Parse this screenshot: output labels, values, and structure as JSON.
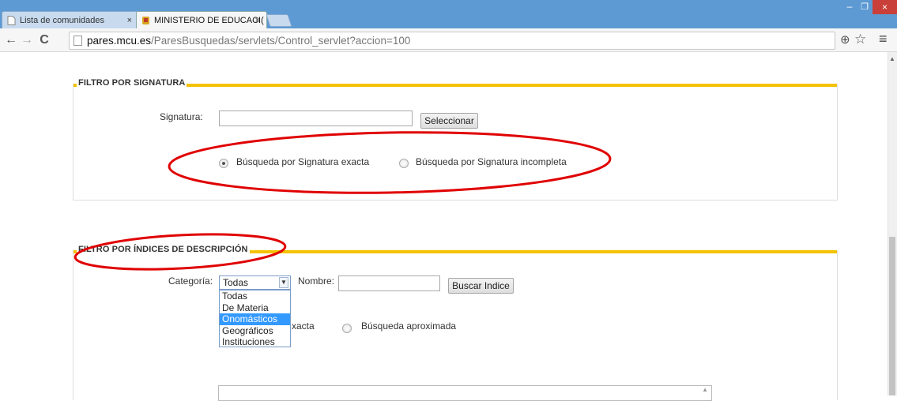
{
  "tabs": [
    {
      "label": "Lista de comunidades",
      "close": "×"
    },
    {
      "label": "MINISTERIO DE EDUCACI(",
      "close": "×"
    }
  ],
  "window": {
    "minimize": "–",
    "maximize": "❐",
    "close": "×"
  },
  "toolbar": {
    "url_host": "pares.mcu.es",
    "url_path": "/ParesBusquedas/servlets/Control_servlet?accion=100"
  },
  "signatura_filter": {
    "legend": "FILTRO POR SIGNATURA",
    "label": "Signatura:",
    "input_value": "",
    "button": "Seleccionar",
    "radio_exact": "Búsqueda por Signatura exacta",
    "radio_incomplete": "Búsqueda por Signatura incompleta",
    "selected": "exact"
  },
  "indices_filter": {
    "legend": "FILTRO POR ÍNDICES DE DESCRIPCIÓN",
    "category_label": "Categoría:",
    "category_selected": "Todas",
    "category_options": [
      "Todas",
      "De Materia",
      "Onomásticos",
      "Geográficos",
      "Instituciones"
    ],
    "highlighted_option": "Onomásticos",
    "name_label": "Nombre:",
    "name_value": "",
    "button": "Buscar Indice",
    "radio_exact_partial": "xacta",
    "radio_approx": "Búsqueda aproximada"
  },
  "colors": {
    "accent_bar": "#f5c200",
    "annotation": "#e00000",
    "titlebar": "#5d9ad3"
  }
}
